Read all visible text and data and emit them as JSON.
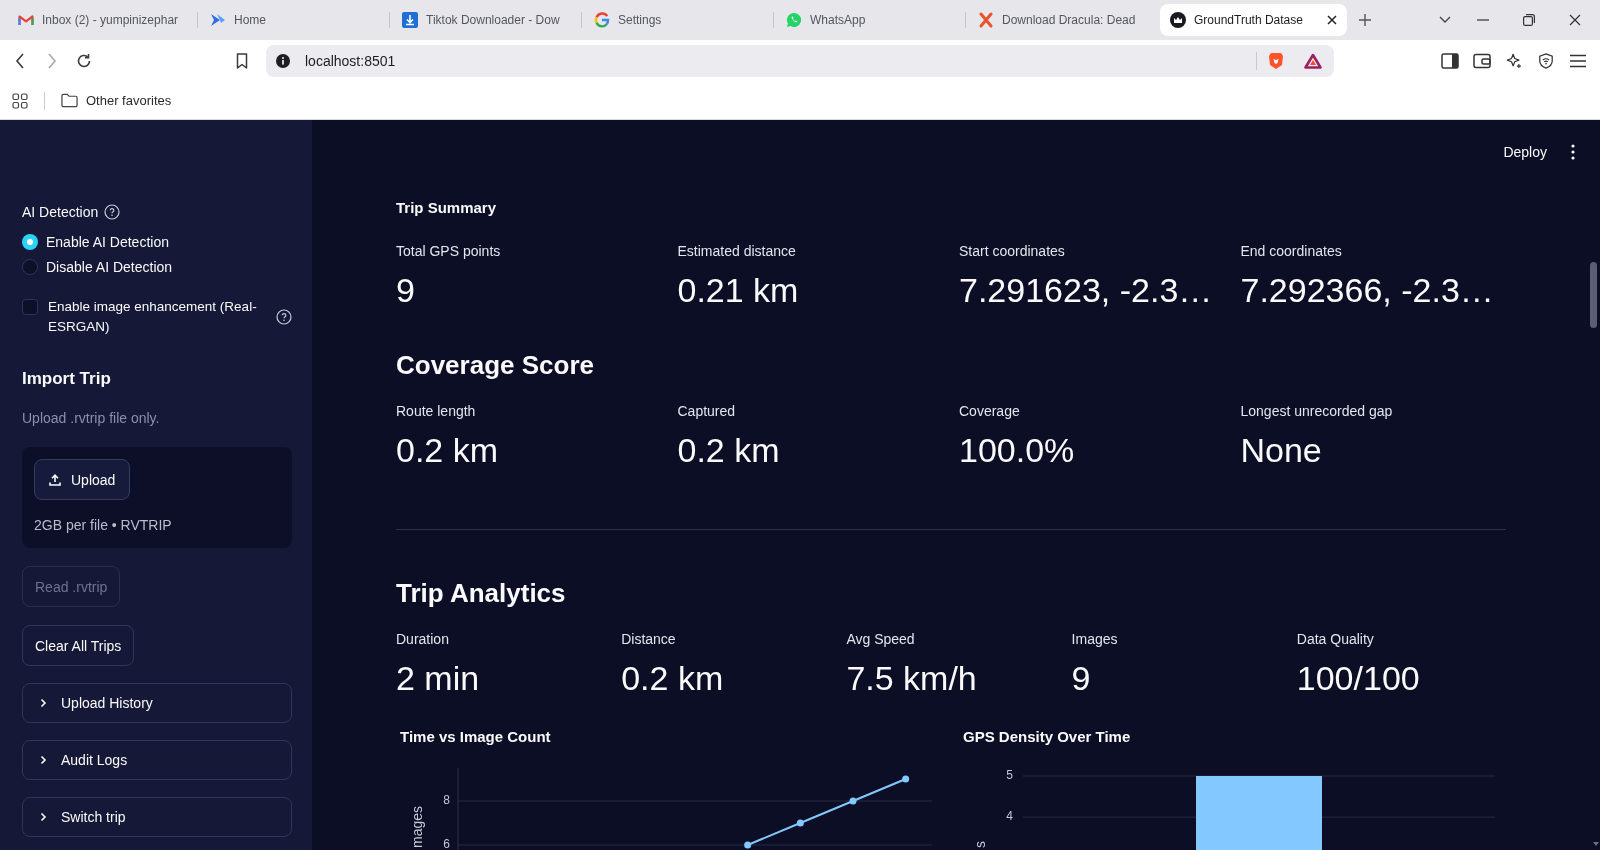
{
  "browser": {
    "tabs": [
      {
        "title": "Inbox (2) - yumpinizephar",
        "selected": false
      },
      {
        "title": "Home",
        "selected": false
      },
      {
        "title": "Tiktok Downloader - Dow",
        "selected": false
      },
      {
        "title": "Settings",
        "selected": false
      },
      {
        "title": "WhatsApp",
        "selected": false
      },
      {
        "title": "Download Dracula: Dead",
        "selected": false
      },
      {
        "title": "GroundTruth Datase",
        "selected": true
      }
    ],
    "address_bar": {
      "url": "localhost:8501"
    },
    "bookmarks": [
      {
        "label": "Other favorites"
      }
    ]
  },
  "header": {
    "deploy": "Deploy"
  },
  "sidebar": {
    "ai_detection": {
      "label": "AI Detection",
      "options": [
        {
          "label": "Enable AI Detection",
          "selected": true
        },
        {
          "label": "Disable AI Detection",
          "selected": false
        }
      ]
    },
    "enhancement": {
      "label": "Enable image enhancement (Real-ESRGAN)",
      "checked": false
    },
    "import": {
      "title": "Import Trip",
      "hint": "Upload .rvtrip file only.",
      "upload_button": "Upload",
      "limits": "2GB per file • RVTRIP"
    },
    "buttons": [
      {
        "label": "Read .rvtrip",
        "disabled": true
      },
      {
        "label": "Clear All Trips",
        "disabled": false
      }
    ],
    "expanders": [
      {
        "label": "Upload History",
        "expanded": false
      },
      {
        "label": "Audit Logs",
        "expanded": false
      },
      {
        "label": "Switch trip",
        "expanded": false
      }
    ]
  },
  "trip_summary": {
    "title": "Trip Summary",
    "metrics": [
      {
        "label": "Total GPS points",
        "value": "9"
      },
      {
        "label": "Estimated distance",
        "value": "0.21 km"
      },
      {
        "label": "Start coordinates",
        "value": "7.291623, -2.3…"
      },
      {
        "label": "End coordinates",
        "value": "7.292366, -2.3…"
      }
    ]
  },
  "coverage_score": {
    "title": "Coverage Score",
    "metrics": [
      {
        "label": "Route length",
        "value": "0.2 km"
      },
      {
        "label": "Captured",
        "value": "0.2 km"
      },
      {
        "label": "Coverage",
        "value": "100.0%"
      },
      {
        "label": "Longest unrecorded gap",
        "value": "None"
      }
    ]
  },
  "trip_analytics": {
    "title": "Trip Analytics",
    "metrics": [
      {
        "label": "Duration",
        "value": "2 min"
      },
      {
        "label": "Distance",
        "value": "0.2 km"
      },
      {
        "label": "Avg Speed",
        "value": "7.5 km/h"
      },
      {
        "label": "Images",
        "value": "9"
      },
      {
        "label": "Data Quality",
        "value": "100/100"
      }
    ]
  },
  "charts": [
    {
      "chart_data": {
        "type": "line",
        "title": "Time vs Image Count",
        "ylabel": "mages",
        "ylim": [
          6,
          9.5
        ],
        "yticks": [
          6,
          8
        ],
        "series": [
          {
            "color": "#83c9ff",
            "marker": "circle",
            "values": [
              null,
              null,
              null,
              null,
              null,
              6,
              7,
              8,
              9
            ]
          }
        ]
      }
    },
    {
      "chart_data": {
        "type": "bar",
        "title": "GPS Density Over Time",
        "ylabel": "s",
        "ylim": [
          3.2,
          5
        ],
        "yticks": [
          4,
          5
        ],
        "series": [
          {
            "color": "#83c9ff",
            "values": [
              5
            ]
          }
        ]
      }
    }
  ]
}
